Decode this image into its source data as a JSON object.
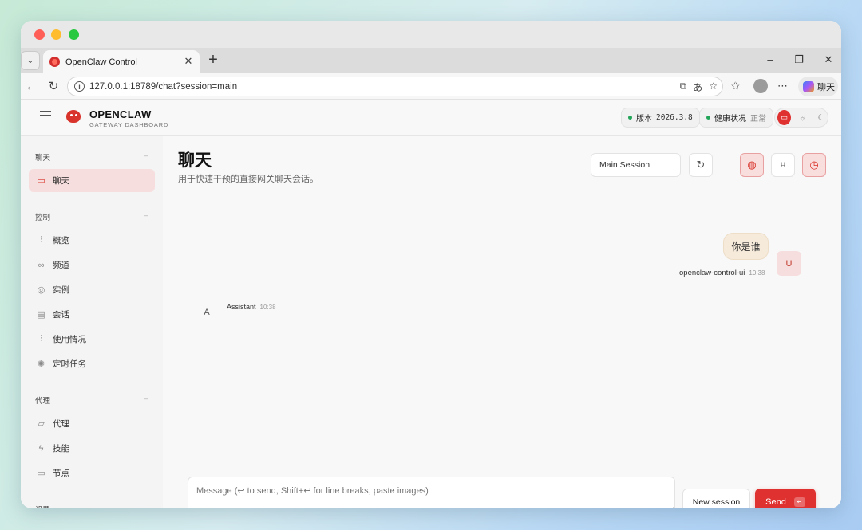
{
  "browser": {
    "tab_title": "OpenClaw Control",
    "tab_close": "✕",
    "new_tab": "+",
    "url": "127.0.0.1:18789/chat?session=main",
    "copilot_label": "聊天"
  },
  "header": {
    "brand_name": "OPENCLAW",
    "brand_sub": "GATEWAY DASHBOARD",
    "version_label": "版本",
    "version_value": "2026.3.8",
    "health_label": "健康状况",
    "health_value": "正常"
  },
  "sidebar": {
    "groups": [
      {
        "label": "聊天",
        "items": [
          {
            "label": "聊天",
            "icon": "chat-icon",
            "active": true
          }
        ]
      },
      {
        "label": "控制",
        "items": [
          {
            "label": "概览",
            "icon": "bar-chart-icon"
          },
          {
            "label": "频道",
            "icon": "link-icon"
          },
          {
            "label": "实例",
            "icon": "radio-icon"
          },
          {
            "label": "会话",
            "icon": "document-icon"
          },
          {
            "label": "使用情况",
            "icon": "bar-chart-icon"
          },
          {
            "label": "定时任务",
            "icon": "loader-icon"
          }
        ]
      },
      {
        "label": "代理",
        "items": [
          {
            "label": "代理",
            "icon": "folder-icon"
          },
          {
            "label": "技能",
            "icon": "bolt-icon"
          },
          {
            "label": "节点",
            "icon": "monitor-icon"
          }
        ]
      },
      {
        "label": "设置",
        "items": []
      }
    ]
  },
  "main": {
    "title": "聊天",
    "subtitle": "用于快速干预的直接网关聊天会话。",
    "session_select": "Main Session"
  },
  "messages": {
    "user_text": "你是谁",
    "user_name": "openclaw-control-ui",
    "user_time": "10:38",
    "user_avatar": "U",
    "assistant_name": "Assistant",
    "assistant_time": "10:38",
    "assistant_avatar": "A"
  },
  "composer": {
    "placeholder": "Message (↩ to send, Shift+↩ for line breaks, paste images)",
    "new_session": "New session",
    "send": "Send",
    "send_kbd": "↵"
  },
  "colors": {
    "accent": "#e03131",
    "status_ok": "#22a559",
    "user_bubble": "#f6eadb"
  }
}
